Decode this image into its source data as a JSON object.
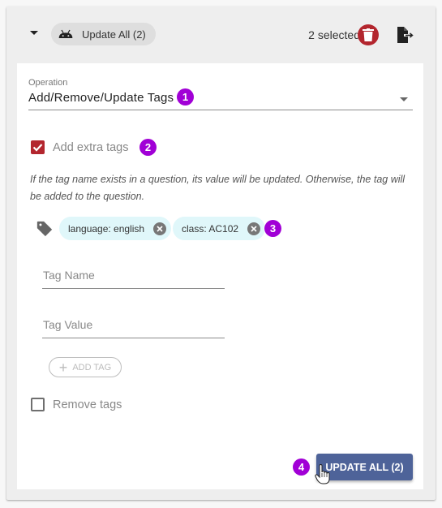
{
  "header": {
    "title_chip": "Update All (2)",
    "title_icon": "android-icon",
    "selected_count_text": "2 selected",
    "delete_icon": "trash-icon",
    "export_icon": "export-file-icon"
  },
  "operation": {
    "label": "Operation",
    "value": "Add/Remove/Update Tags"
  },
  "add_extra_tags": {
    "label": "Add extra tags",
    "checked": true
  },
  "help_text": "If the tag name exists in a question, its value will be updated. Otherwise, the tag will be added to the question.",
  "tags": [
    {
      "label": "language: english"
    },
    {
      "label": "class: AC102"
    }
  ],
  "tag_name_field": {
    "placeholder": "Tag Name",
    "value": ""
  },
  "tag_value_field": {
    "placeholder": "Tag Value",
    "value": ""
  },
  "add_tag_button": {
    "label": "ADD TAG",
    "disabled": true
  },
  "remove_tags": {
    "label": "Remove tags",
    "checked": false
  },
  "update_all_button": {
    "label": "UPDATE ALL (2)"
  },
  "annotations": [
    "1",
    "2",
    "3",
    "4"
  ],
  "colors": {
    "accent_red": "#b3262e",
    "primary_button": "#4e6399",
    "badge_purple": "#a100d6",
    "tag_chip_bg": "#e0f7fa"
  }
}
